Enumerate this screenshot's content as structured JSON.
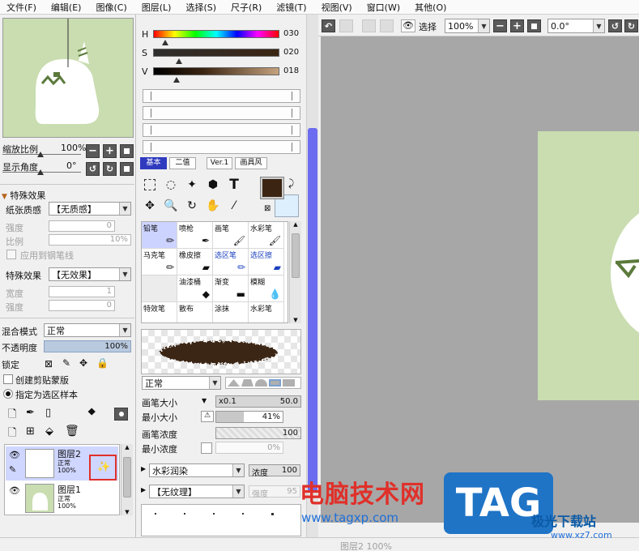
{
  "menu": [
    "文件(F)",
    "编辑(E)",
    "图像(C)",
    "图层(L)",
    "选择(S)",
    "尺子(R)",
    "滤镜(T)",
    "视图(V)",
    "窗口(W)",
    "其他(O)"
  ],
  "navigator": {
    "zoom_label": "缩放比例",
    "zoom_value": "100%",
    "angle_label": "显示角度",
    "angle_value": "0°"
  },
  "effects": {
    "header": "特殊效果",
    "paper_label": "纸张质感",
    "paper_value": "【无质感】",
    "strength_label": "强度",
    "strength_value": "0",
    "ratio_label": "比例",
    "ratio_value": "10%",
    "apply_pen_label": "应用到钢笔线",
    "effect_label": "特殊效果",
    "effect_value": "【无效果】",
    "width_label": "宽度",
    "width_value": "1",
    "strength2_label": "强度",
    "strength2_value": "0"
  },
  "layer_props": {
    "blend_label": "混合模式",
    "blend_value": "正常",
    "opacity_label": "不透明度",
    "opacity_value": "100%",
    "opacity_fraction": 1.0,
    "lock_label": "锁定",
    "clip_label": "创建剪贴蒙版",
    "sample_label": "指定为选区样本"
  },
  "layers": [
    {
      "name": "图层2",
      "mode": "正常",
      "opacity": "100%",
      "selected": true
    },
    {
      "name": "图层1",
      "mode": "正常",
      "opacity": "100%",
      "selected": false
    }
  ],
  "color": {
    "h_label": "H",
    "h_value": "030",
    "s_label": "S",
    "s_value": "020",
    "v_label": "V",
    "v_value": "018",
    "fg": "#3b2512",
    "bg": "#ddeefc"
  },
  "tabs": [
    "基本",
    "二值",
    "Ver.1",
    "画具风"
  ],
  "brushes": [
    {
      "name": "铅笔",
      "icon": "✏",
      "blue": false,
      "selected": true
    },
    {
      "name": "喷枪",
      "icon": "✒",
      "blue": false,
      "selected": false
    },
    {
      "name": "画笔",
      "icon": "🖌",
      "blue": false,
      "selected": false
    },
    {
      "name": "水彩笔",
      "icon": "🖌",
      "blue": false,
      "selected": false
    },
    {
      "name": "马克笔",
      "icon": "✏",
      "blue": false,
      "selected": false
    },
    {
      "name": "橡皮擦",
      "icon": "▰",
      "blue": false,
      "selected": false
    },
    {
      "name": "选区笔",
      "icon": "✏",
      "blue": true,
      "selected": false
    },
    {
      "name": "选区擦",
      "icon": "▰",
      "blue": true,
      "selected": false
    },
    {
      "name": "",
      "icon": "",
      "blue": false,
      "selected": false
    },
    {
      "name": "油漆桶",
      "icon": "◆",
      "blue": false,
      "selected": false
    },
    {
      "name": "渐变",
      "icon": "▬",
      "blue": false,
      "selected": false
    },
    {
      "name": "模糊",
      "icon": "💧",
      "blue": false,
      "selected": false
    },
    {
      "name": "特效笔",
      "icon": "",
      "blue": false,
      "selected": false
    },
    {
      "name": "散布",
      "icon": "",
      "blue": false,
      "selected": false
    },
    {
      "name": "涂抹",
      "icon": "",
      "blue": false,
      "selected": false
    },
    {
      "name": "水彩笔",
      "icon": "",
      "blue": false,
      "selected": false
    }
  ],
  "brush_settings": {
    "mode_value": "正常",
    "size_label": "画笔大小",
    "size_mult": "x0.1",
    "size_value": "50.0",
    "min_size_label": "最小大小",
    "min_size_value": "41%",
    "min_size_fraction": 0.41,
    "density_label": "画笔浓度",
    "density_value": "100",
    "min_density_label": "最小浓度",
    "min_density_value": "0%",
    "blend_value": "水彩润染",
    "blend_density_label": "浓度",
    "blend_density_value": "100",
    "texture_value": "【无纹理】",
    "texture_strength_label": "强度",
    "texture_strength_value": "95"
  },
  "toolbar": {
    "select_label": "选择",
    "zoom_value": "100%",
    "angle_value": "0.0°"
  },
  "watermark": {
    "site_name": "电脑技术网",
    "site_url": "www.tagxp.com",
    "tag": "TAG",
    "dl_name": "极光下载站",
    "dl_url": "www.xz7.com"
  },
  "statusbar": {
    "text": "图层2 100%"
  }
}
